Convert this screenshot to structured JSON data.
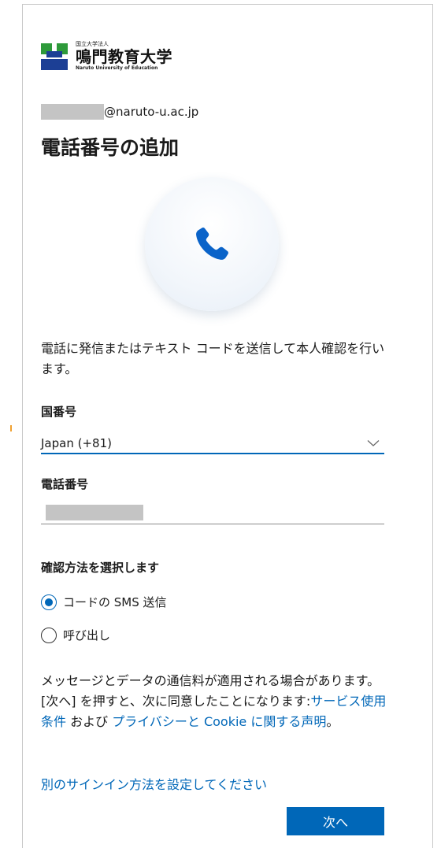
{
  "logo": {
    "small_text": "国立大学法人",
    "main_text": "鳴門教育大学",
    "english_text": "Naruto University of Education"
  },
  "account": {
    "domain": "@naruto-u.ac.jp"
  },
  "page": {
    "title": "電話番号の追加",
    "description": "電話に発信またはテキスト コードを送信して本人確認を行います。"
  },
  "form": {
    "country_label": "国番号",
    "country_value": "Japan (+81)",
    "phone_label": "電話番号",
    "phone_value": "",
    "method_label": "確認方法を選択します",
    "methods": [
      {
        "label": "コードの SMS 送信",
        "selected": true
      },
      {
        "label": "呼び出し",
        "selected": false
      }
    ]
  },
  "legal": {
    "text_before": "メッセージとデータの通信料が適用される場合があります。[次へ] を押すと、次に同意したことになります:",
    "terms_link": "サービス使用条件",
    "conjunction": " および ",
    "privacy_link": "プライバシーと Cookie に関する声明",
    "text_after": "。"
  },
  "links": {
    "alternate_signin": "別のサインイン方法を設定してください"
  },
  "buttons": {
    "next": "次へ"
  },
  "colors": {
    "accent": "#0067b8",
    "phone_icon": "#0a63c9"
  },
  "icons": {
    "phone": "phone-icon",
    "chevron": "chevron-down-icon"
  }
}
